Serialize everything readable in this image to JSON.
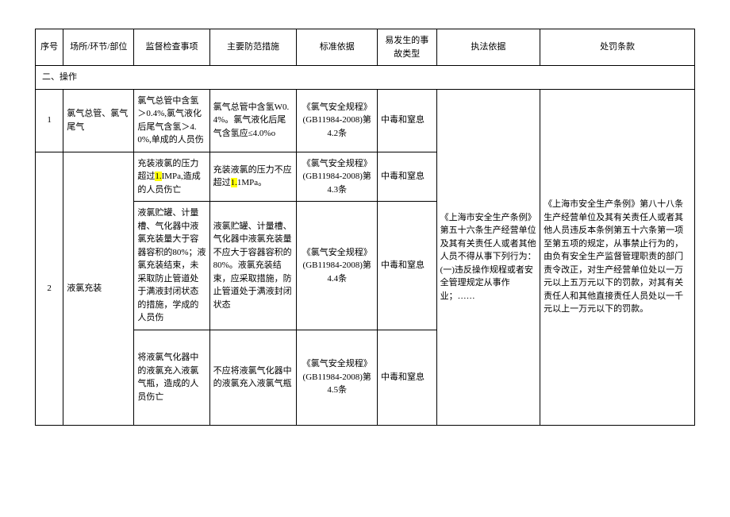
{
  "headers": {
    "col1": "序号",
    "col2": "场所/环节/部位",
    "col3": "监督检查事项",
    "col4": "主要防范措施",
    "col5": "标准依据",
    "col6": "易发生的事故类型",
    "col7": "执法依据",
    "col8": "处罚条款"
  },
  "section": "二、操作",
  "highlight": {
    "h1": "1.",
    "h2": "1."
  },
  "rows": [
    {
      "no": "1",
      "place": "氯气总管、氯气尾气",
      "item": "氯气总管中含氢＞0.4%,氯气液化后尾气含氢＞4.0%,单成的人员伤",
      "measure": "氯气总管中含氢W0.4%。氯气液化后尾气含氢应≤4.0%o",
      "standard": "《氯气安全规程》(GB11984-2008)第4.2条",
      "accident": "中毒和窒息"
    },
    {
      "item_pre": "充装液氯的压力超过",
      "item_post": "IMPa,造成的人员伤亡",
      "measure_pre": "充装液氯的压力不应超过",
      "measure_post": "1MPa。",
      "standard": "《氯气安全规程》(GB11984-2008)第4.3条",
      "accident": "中毒和窒息"
    },
    {
      "no": "2",
      "place": "液氯充装",
      "item": "液氯贮罐、计量槽、气化器中液氯充装量大于容器容积的80%；液氯充装结束，未采取防止管道处于满液封闭状态的措施，学成的人员伤",
      "measure": "液氯贮罐、计量槽、气化器中液氯充装量不应大于容器容积的80%。液氯充装结束，应采取措施，防止管道处于满液封闭状态",
      "standard": "《氯气安全规程》(GB11984-2008)第4.4条",
      "accident": "中毒和窒息"
    },
    {
      "item": "将液氯气化器中的液氯充入液氯气瓶，造成的人员伤亡",
      "measure": "不应将液氯气化器中的液氯充入液氯气瓶",
      "standard": "《氯气安全规程》(GB11984-2008)第4.5条",
      "accident": "中毒和窒息"
    }
  ],
  "law_basis": "《上海市安全生产条例》第五十六条生产经营单位及其有关责任人或者其他人员不得从事下列行为：(一)违反操作规程或者安全管理规定从事作业；……",
  "penalty": "《上海市安全生产条例》第八十八条生产经营单位及其有关责任人或者其他人员违反本条例第五十六条第一项至第五项的规定，从事禁止行为的，由负有安全生产监督管理职责的部门责令改正，对生产经营单位处以一万元以上五万元以下的罚款，对其有关责任人和其他直接责任人员处以一千元以上一万元以下的罚款。"
}
